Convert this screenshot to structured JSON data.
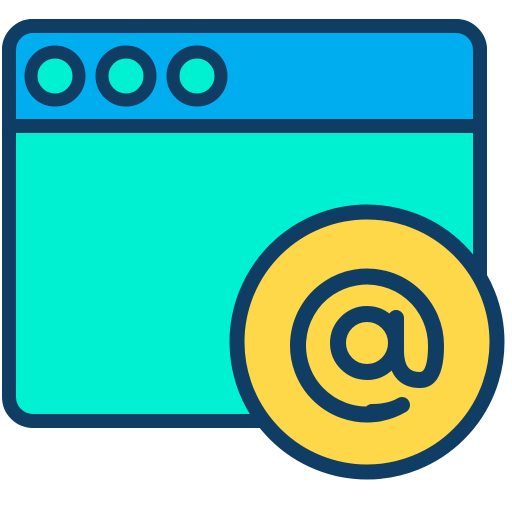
{
  "icon": {
    "name": "browser-window-email-at-icon",
    "colors": {
      "outline": "#0f3d64",
      "title_bar": "#00aeef",
      "window_body": "#00f0d2",
      "window_dots": "#00f0d2",
      "badge": "#ffd84a",
      "at_symbol": "#0f3d64"
    },
    "window": {
      "title_bar_dots": [
        "dot-1",
        "dot-2",
        "dot-3"
      ]
    },
    "badge": {
      "symbol": "@"
    }
  }
}
